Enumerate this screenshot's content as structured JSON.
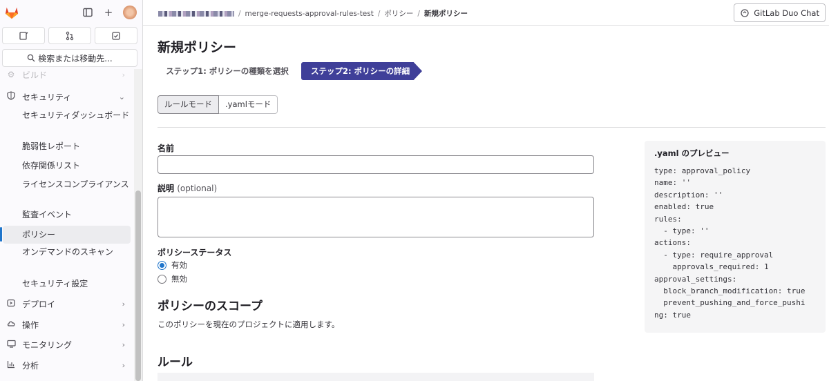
{
  "sidebar": {
    "search_label": "検索または移動先...",
    "nav": [
      {
        "label": "ビルド",
        "icon": "rocket-icon"
      },
      {
        "label": "セキュリティ",
        "icon": "shield-icon",
        "expanded": true
      },
      {
        "label": "デプロイ",
        "icon": "deploy-icon"
      },
      {
        "label": "操作",
        "icon": "cloud-icon"
      },
      {
        "label": "モニタリング",
        "icon": "monitor-icon"
      },
      {
        "label": "分析",
        "icon": "chart-icon"
      }
    ],
    "security_items": [
      "セキュリティダッシュボード",
      "脆弱性レポート",
      "依存関係リスト",
      "ライセンスコンプライアンス",
      "監査イベント",
      "ポリシー",
      "オンデマンドのスキャン",
      "セキュリティ設定"
    ],
    "active_item": "ポリシー"
  },
  "header": {
    "crumb_project": "merge-requests-approval-rules-test",
    "crumb_section": "ポリシー",
    "crumb_current": "新規ポリシー",
    "duo_label": "GitLab Duo Chat"
  },
  "main": {
    "title": "新規ポリシー",
    "step1": "ステップ1: ポリシーの種類を選択",
    "step2": "ステップ2: ポリシーの詳細",
    "mode_rule": "ルールモード",
    "mode_yaml": ".yamlモード",
    "name_label": "名前",
    "name_value": "",
    "desc_label": "説明",
    "desc_optional": "(optional)",
    "desc_value": "",
    "status_label": "ポリシーステータス",
    "status_enabled": "有効",
    "status_disabled": "無効",
    "scope_title": "ポリシーのスコープ",
    "scope_desc": "このポリシーを現在のプロジェクトに適用します。",
    "rules_title": "ルール"
  },
  "preview": {
    "title": ".yaml のプレビュー",
    "code": "type: approval_policy\nname: ''\ndescription: ''\nenabled: true\nrules:\n  - type: ''\nactions:\n  - type: require_approval\n    approvals_required: 1\napproval_settings:\n  block_branch_modification: true\n  prevent_pushing_and_force_pushi\nng: true"
  },
  "colors": {
    "accent": "#3f3f99",
    "link": "#1f75cb",
    "brand": "#fc6d26"
  }
}
